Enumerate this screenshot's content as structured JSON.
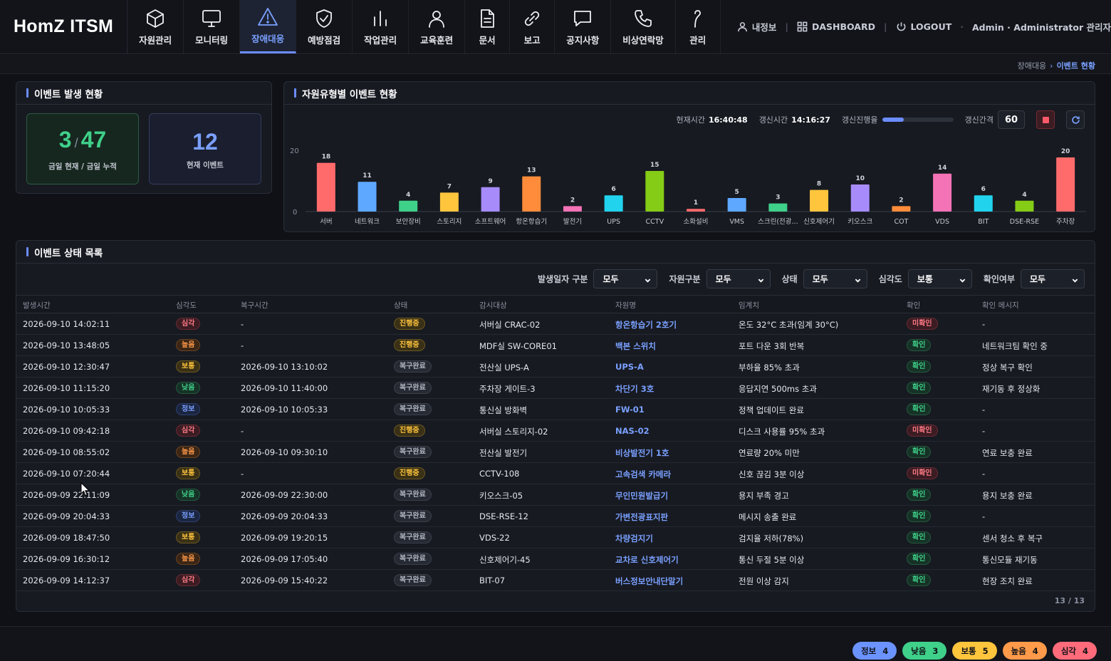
{
  "app": {
    "title": "HomZ ITSM"
  },
  "nav": [
    {
      "label": "자원관리",
      "icon": "cube-icon"
    },
    {
      "label": "모니터링",
      "icon": "monitor-icon"
    },
    {
      "label": "장애대응",
      "icon": "warning-icon",
      "active": true
    },
    {
      "label": "예방점검",
      "icon": "shield-check-icon"
    },
    {
      "label": "작업관리",
      "icon": "bar-chart-icon"
    },
    {
      "label": "교육훈련",
      "icon": "user-icon"
    },
    {
      "label": "문서",
      "icon": "document-icon"
    },
    {
      "label": "보고",
      "icon": "link-icon"
    },
    {
      "label": "공지사항",
      "icon": "message-icon"
    },
    {
      "label": "비상연락망",
      "icon": "phone-icon"
    },
    {
      "label": "관리",
      "icon": "hook-icon"
    }
  ],
  "topbar": {
    "myinfo": "내정보",
    "dashboard": "DASHBOARD",
    "logout": "LOGOUT",
    "user": "Admin · Administrator 관리자"
  },
  "breadcrumb": {
    "parent": "장애대응",
    "current": "이벤트 현황"
  },
  "summary": {
    "title": "이벤트 발생 현황",
    "today": "3",
    "total": "47",
    "today_label": "금일 현재 / 금일 누적",
    "current": "12",
    "current_label": "현재 이벤트"
  },
  "chart_panel": {
    "title": "자원유형별 이벤트 현황",
    "now_label": "현재시간",
    "now_value": "16:40:48",
    "refresh_label": "갱신시간",
    "refresh_value": "14:16:27",
    "progress_label": "갱신진행율",
    "progress": 0.3,
    "interval_label": "갱신간격",
    "interval_value": "60"
  },
  "chart_data": {
    "type": "bar",
    "categories": [
      "서버",
      "네트워크",
      "보안장비",
      "스토리지",
      "소프트웨어",
      "항온항습기",
      "발전기",
      "UPS",
      "CCTV",
      "소화설비",
      "VMS",
      "스크린(전광...",
      "신호제어기",
      "키오스크",
      "COT",
      "VDS",
      "BIT",
      "DSE-RSE",
      "주차장"
    ],
    "values": [
      18,
      11,
      4,
      7,
      9,
      13,
      2,
      6,
      15,
      1,
      5,
      3,
      8,
      10,
      2,
      14,
      6,
      4,
      20
    ],
    "colors": [
      "#ff6b6b",
      "#5fa8ff",
      "#3fd08a",
      "#ffc53d",
      "#a78bfa",
      "#ff8c3a",
      "#f472b6",
      "#22d3ee",
      "#84cc16",
      "#ff6b6b",
      "#5fa8ff",
      "#3fd08a",
      "#ffc53d",
      "#a78bfa",
      "#ff8c3a",
      "#f472b6",
      "#22d3ee",
      "#84cc16",
      "#ff6b6b"
    ],
    "ylim": [
      0,
      20
    ],
    "yticks": [
      "0",
      "20"
    ]
  },
  "list": {
    "title": "이벤트 상태 목록",
    "filters": [
      {
        "label": "발생일자 구분",
        "value": "모두"
      },
      {
        "label": "자원구분",
        "value": "모두"
      },
      {
        "label": "상태",
        "value": "모두"
      },
      {
        "label": "심각도",
        "value": "보통"
      },
      {
        "label": "확인여부",
        "value": "모두"
      }
    ],
    "columns": [
      "발생시간",
      "심각도",
      "복구시간",
      "상태",
      "감시대상",
      "자원명",
      "임계치",
      "확인",
      "확인 메시지"
    ],
    "rows": [
      [
        "2026-09-10 14:02:11",
        "심각",
        "-",
        "진행중",
        "서버실 CRAC-02",
        "항온항습기 2호기",
        "온도 32°C 초과(임계 30°C)",
        "미확인",
        "-"
      ],
      [
        "2026-09-10 13:48:05",
        "높음",
        "-",
        "진행중",
        "MDF실 SW-CORE01",
        "백본 스위치",
        "포트 다운 3회 반복",
        "확인",
        "네트워크팀 확인 중"
      ],
      [
        "2026-09-10 12:30:47",
        "보통",
        "2026-09-10 13:10:02",
        "복구완료",
        "전산실 UPS-A",
        "UPS-A",
        "부하율 85% 초과",
        "확인",
        "정상 복구 확인"
      ],
      [
        "2026-09-10 11:15:20",
        "낮음",
        "2026-09-10 11:40:00",
        "복구완료",
        "주차장 게이트-3",
        "차단기 3호",
        "응답지연 500ms 초과",
        "확인",
        "재기동 후 정상화"
      ],
      [
        "2026-09-10 10:05:33",
        "정보",
        "2026-09-10 10:05:33",
        "복구완료",
        "통신실 방화벽",
        "FW-01",
        "정책 업데이트 완료",
        "확인",
        "-"
      ],
      [
        "2026-09-10 09:42:18",
        "심각",
        "-",
        "진행중",
        "서버실 스토리지-02",
        "NAS-02",
        "디스크 사용률 95% 초과",
        "미확인",
        "-"
      ],
      [
        "2026-09-10 08:55:02",
        "높음",
        "2026-09-10 09:30:10",
        "복구완료",
        "전산실 발전기",
        "비상발전기 1호",
        "연료량 20% 미만",
        "확인",
        "연료 보충 완료"
      ],
      [
        "2026-09-10 07:20:44",
        "보통",
        "-",
        "진행중",
        "CCTV-108",
        "고속검색 카메라",
        "신호 끊김 3분 이상",
        "미확인",
        "-"
      ],
      [
        "2026-09-09 22:11:09",
        "낮음",
        "2026-09-09 22:30:00",
        "복구완료",
        "키오스크-05",
        "무인민원발급기",
        "용지 부족 경고",
        "확인",
        "용지 보충 완료"
      ],
      [
        "2026-09-09 20:04:33",
        "정보",
        "2026-09-09 20:04:33",
        "복구완료",
        "DSE-RSE-12",
        "가변전광표지판",
        "메시지 송출 완료",
        "확인",
        "-"
      ],
      [
        "2026-09-09 18:47:50",
        "보통",
        "2026-09-09 19:20:15",
        "복구완료",
        "VDS-22",
        "차량검지기",
        "검지율 저하(78%)",
        "확인",
        "센서 청소 후 복구"
      ],
      [
        "2026-09-09 16:30:12",
        "높음",
        "2026-09-09 17:05:40",
        "복구완료",
        "신호제어기-45",
        "교차로 신호제어기",
        "통신 두절 5분 이상",
        "확인",
        "통신모듈 재기동"
      ],
      [
        "2026-09-09 14:12:37",
        "심각",
        "2026-09-09 15:40:22",
        "복구완료",
        "BIT-07",
        "버스정보안내단말기",
        "전원 이상 감지",
        "확인",
        "현장 조치 완료"
      ]
    ],
    "pager": "13 / 13"
  },
  "legend": [
    {
      "label": "정보",
      "count": "4",
      "color": "#6b93ff"
    },
    {
      "label": "낮음",
      "count": "3",
      "color": "#3fd08a"
    },
    {
      "label": "보통",
      "count": "5",
      "color": "#ffc53d"
    },
    {
      "label": "높음",
      "count": "4",
      "color": "#ff9a4a"
    },
    {
      "label": "심각",
      "count": "4",
      "color": "#ff6b7a"
    }
  ]
}
